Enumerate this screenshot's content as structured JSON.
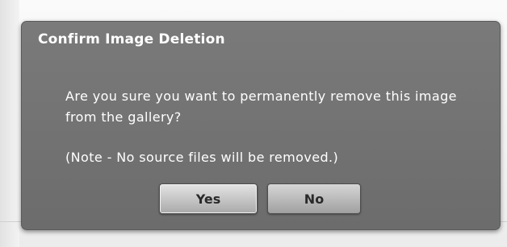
{
  "dialog": {
    "title": "Confirm Image Deletion",
    "message": "Are you sure you want to permanently remove this image from the gallery?",
    "note": "(Note - No source files will be removed.)",
    "yes_label": "Yes",
    "no_label": "No"
  },
  "colors": {
    "dialog_background": "#747474",
    "text": "#ffffff",
    "button_text": "#2a2a2a",
    "page_background": "#f3f3f3"
  }
}
